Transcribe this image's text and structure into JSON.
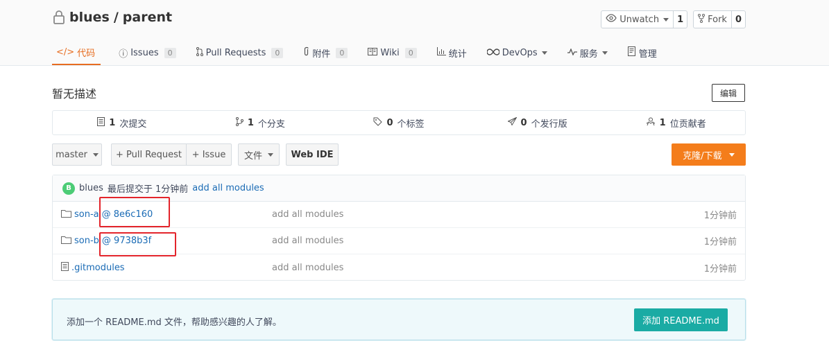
{
  "repo": {
    "owner": "blues",
    "sep": "/",
    "name": "parent"
  },
  "actions": {
    "watch": {
      "label": "Unwatch",
      "count": "1"
    },
    "fork": {
      "label": "Fork",
      "count": "0"
    }
  },
  "tabs": [
    {
      "label": "代码",
      "count": ""
    },
    {
      "label": "Issues",
      "count": "0"
    },
    {
      "label": "Pull Requests",
      "count": "0"
    },
    {
      "label": "附件",
      "count": "0"
    },
    {
      "label": "Wiki",
      "count": "0"
    },
    {
      "label": "统计",
      "count": ""
    },
    {
      "label": "DevOps",
      "count": ""
    },
    {
      "label": "服务",
      "count": ""
    },
    {
      "label": "管理",
      "count": ""
    }
  ],
  "description": "暂无描述",
  "edit_label": "编辑",
  "stats": [
    {
      "num": "1",
      "label": "次提交"
    },
    {
      "num": "1",
      "label": "个分支"
    },
    {
      "num": "0",
      "label": "个标签"
    },
    {
      "num": "0",
      "label": "个发行版"
    },
    {
      "num": "1",
      "label": "位贡献者"
    }
  ],
  "toolbar": {
    "branch": "master",
    "pull_request": "+ Pull Request",
    "issue": "+ Issue",
    "file": "文件",
    "web_ide": "Web IDE",
    "clone": "克隆/下载"
  },
  "commit": {
    "avatar": "B",
    "author": "blues",
    "text": "最后提交于 1分钟前",
    "message": "add all modules"
  },
  "files": [
    {
      "name": "son-a",
      "ref": "@ 8e6c160",
      "message": "add all modules",
      "time": "1分钟前"
    },
    {
      "name": "son-b",
      "ref": "@ 9738b3f",
      "message": "add all modules",
      "time": "1分钟前"
    },
    {
      "name": ".gitmodules",
      "ref": "",
      "message": "add all modules",
      "time": "1分钟前"
    }
  ],
  "readme": {
    "text": "添加一个 README.md 文件，帮助感兴趣的人了解。",
    "button": "添加 README.md"
  },
  "colors": {
    "accent": "#e76d21",
    "clone": "#f47d1b",
    "teal": "#1aaba4",
    "link": "#1a6bb5",
    "highlight": "#e3242b"
  }
}
